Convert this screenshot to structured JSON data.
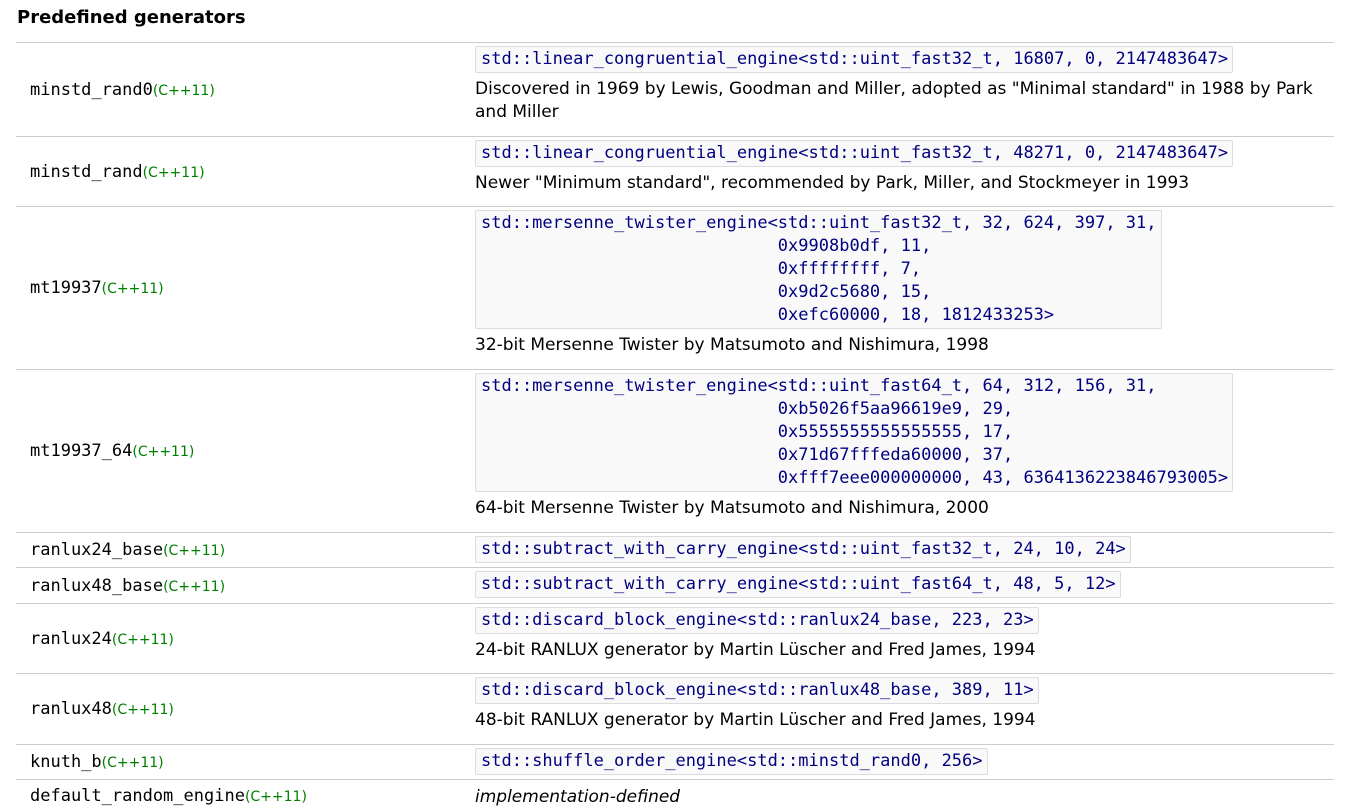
{
  "heading": "Predefined generators",
  "since": "(C++11)",
  "rows": [
    {
      "name": "minstd_rand0",
      "code": [
        "std::linear_congruential_engine<std::uint_fast32_t, 16807, 0, 2147483647>"
      ],
      "desc": "Discovered in 1969 by Lewis, Goodman and Miller, adopted as \"Minimal standard\" in 1988 by Park and Miller"
    },
    {
      "name": "minstd_rand",
      "code": [
        "std::linear_congruential_engine<std::uint_fast32_t, 48271, 0, 2147483647>"
      ],
      "desc": "Newer \"Minimum standard\", recommended by Park, Miller, and Stockmeyer in 1993"
    },
    {
      "name": "mt19937",
      "code": [
        "std::mersenne_twister_engine<std::uint_fast32_t, 32, 624, 397, 31,",
        "                             0x9908b0df, 11,",
        "                             0xffffffff, 7,",
        "                             0x9d2c5680, 15,",
        "                             0xefc60000, 18, 1812433253>"
      ],
      "desc": "32-bit Mersenne Twister by Matsumoto and Nishimura, 1998"
    },
    {
      "name": "mt19937_64",
      "code": [
        "std::mersenne_twister_engine<std::uint_fast64_t, 64, 312, 156, 31,",
        "                             0xb5026f5aa96619e9, 29,",
        "                             0x5555555555555555, 17,",
        "                             0x71d67fffeda60000, 37,",
        "                             0xfff7eee000000000, 43, 6364136223846793005>"
      ],
      "desc": "64-bit Mersenne Twister by Matsumoto and Nishimura, 2000"
    },
    {
      "name": "ranlux24_base",
      "code": [
        "std::subtract_with_carry_engine<std::uint_fast32_t, 24, 10, 24>"
      ],
      "desc": ""
    },
    {
      "name": "ranlux48_base",
      "code": [
        "std::subtract_with_carry_engine<std::uint_fast64_t, 48, 5, 12>"
      ],
      "desc": ""
    },
    {
      "name": "ranlux24",
      "code": [
        "std::discard_block_engine<std::ranlux24_base, 223, 23>"
      ],
      "desc": "24-bit RANLUX generator by Martin Lüscher and Fred James, 1994"
    },
    {
      "name": "ranlux48",
      "code": [
        "std::discard_block_engine<std::ranlux48_base, 389, 11>"
      ],
      "desc": "48-bit RANLUX generator by Martin Lüscher and Fred James, 1994"
    },
    {
      "name": "knuth_b",
      "code": [
        "std::shuffle_order_engine<std::minstd_rand0, 256>"
      ],
      "desc": ""
    },
    {
      "name": "default_random_engine",
      "code": [],
      "desc": "implementation-defined"
    }
  ]
}
